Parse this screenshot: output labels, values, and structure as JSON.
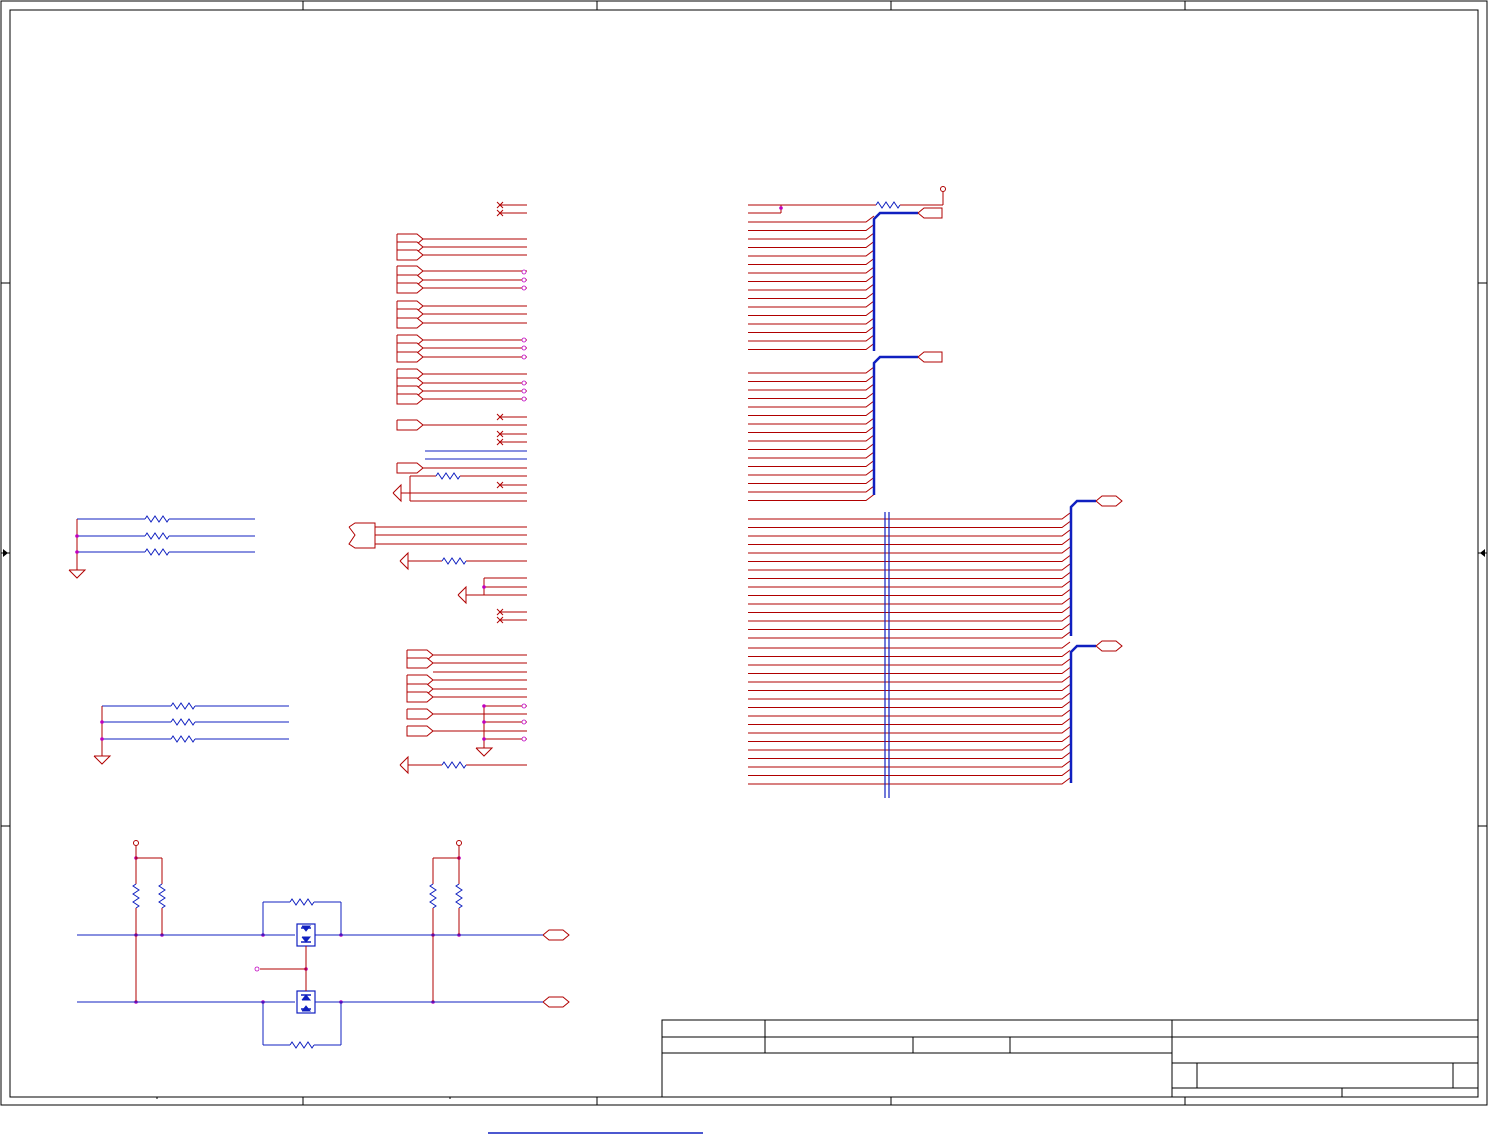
{
  "sheet": {
    "title_block": {
      "rows": 3,
      "cells": [
        "",
        "",
        "",
        "",
        "",
        "",
        "",
        ""
      ]
    },
    "border_zones": {
      "columns": 5,
      "rows": 4
    }
  },
  "colors": {
    "net_wire": "#b00000",
    "component_body": "#1020c0",
    "junction": "#c000c0",
    "border": "#000000",
    "no_connect": "#b00000"
  },
  "components": {
    "main_ic": {
      "sections": 3,
      "halves": 2
    },
    "switch_fets": 2,
    "pullup_resistors": 4,
    "series_resistors": 10
  },
  "icons": {
    "ground": "ground-symbol-icon",
    "power": "power-port-icon",
    "offpage": "offpage-connector-icon",
    "resistor": "resistor-icon",
    "mosfet": "mosfet-icon",
    "no_connect": "no-connect-icon"
  }
}
